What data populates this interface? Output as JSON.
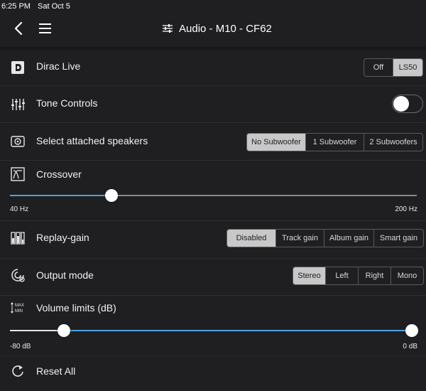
{
  "status_bar": {
    "time": "6:25 PM",
    "date": "Sat Oct 5"
  },
  "nav": {
    "title": "Audio - M10 - CF62",
    "back_icon": "back-chevron-icon",
    "menu_icon": "hamburger-menu-icon",
    "title_icon": "sliders-icon"
  },
  "colors": {
    "accent": "#4aa3e0",
    "background": "#1f1f21",
    "selected_segment": "#c8c8c8"
  },
  "rows": {
    "dirac": {
      "label": "Dirac Live",
      "icon": "dirac-icon",
      "options": [
        "Off",
        "LS50"
      ],
      "selected": "LS50"
    },
    "tone": {
      "label": "Tone Controls",
      "icon": "tone-sliders-icon",
      "toggle_on": false
    },
    "speakers": {
      "label": "Select attached speakers",
      "icon": "speaker-icon",
      "options": [
        "No Subwoofer",
        "1 Subwoofer",
        "2 Subwoofers"
      ],
      "selected": "No Subwoofer"
    },
    "crossover": {
      "label": "Crossover",
      "icon": "crossover-icon",
      "min_label": "40 Hz",
      "max_label": "200 Hz",
      "level_fraction": 0.25
    },
    "replay": {
      "label": "Replay-gain",
      "icon": "replay-gain-icon",
      "options": [
        "Disabled",
        "Track gain",
        "Album gain",
        "Smart gain"
      ],
      "selected": "Disabled"
    },
    "output": {
      "label": "Output mode",
      "icon": "output-mode-icon",
      "options": [
        "Stereo",
        "Left",
        "Right",
        "Mono"
      ],
      "selected": "Stereo"
    },
    "volume": {
      "label": "Volume limits (dB)",
      "icon": "volume-limits-icon",
      "icon_text_top": "MAX",
      "icon_text_bottom": "MIN",
      "min_label": "-80 dB",
      "max_label": "0 dB",
      "low_fraction": 0.135,
      "high_fraction": 1.0
    },
    "reset": {
      "label": "Reset All",
      "icon": "reset-icon"
    }
  }
}
